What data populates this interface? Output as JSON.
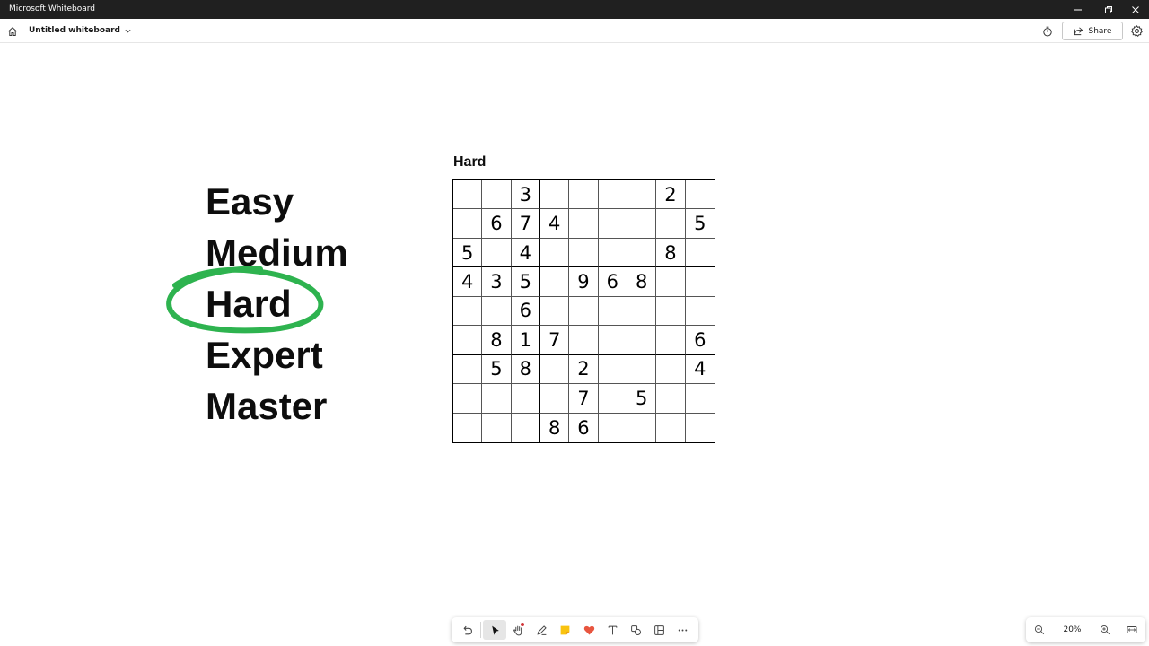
{
  "window": {
    "title": "Microsoft Whiteboard"
  },
  "topbar": {
    "board_name": "Untitled whiteboard",
    "share_label": "Share"
  },
  "difficulty_list": [
    "Easy",
    "Medium",
    "Hard",
    "Expert",
    "Master"
  ],
  "selected_difficulty": "Hard",
  "ink_color": "#2eb34f",
  "sudoku": {
    "title": "Hard",
    "grid": [
      [
        "",
        "",
        "3",
        "",
        "",
        "",
        "",
        "2",
        ""
      ],
      [
        "",
        "6",
        "7",
        "4",
        "",
        "",
        "",
        "",
        "5"
      ],
      [
        "5",
        "",
        "4",
        "",
        "",
        "",
        "",
        "8",
        ""
      ],
      [
        "4",
        "3",
        "5",
        "",
        "9",
        "6",
        "8",
        "",
        ""
      ],
      [
        "",
        "",
        "6",
        "",
        "",
        "",
        "",
        "",
        ""
      ],
      [
        "",
        "8",
        "1",
        "7",
        "",
        "",
        "",
        "",
        "6"
      ],
      [
        "",
        "5",
        "8",
        "",
        "2",
        "",
        "",
        "",
        "4"
      ],
      [
        "",
        "",
        "",
        "",
        "7",
        "",
        "5",
        "",
        ""
      ],
      [
        "",
        "",
        "",
        "8",
        "6",
        "",
        "",
        "",
        ""
      ]
    ]
  },
  "toolbar": {
    "tools": [
      "undo-icon",
      "select-icon",
      "hand-icon",
      "pen-icon",
      "sticky-note-icon",
      "reaction-icon",
      "text-icon",
      "shapes-icon",
      "templates-icon",
      "more-icon"
    ],
    "active_tool": "select-icon"
  },
  "zoom": {
    "level": "20%"
  }
}
